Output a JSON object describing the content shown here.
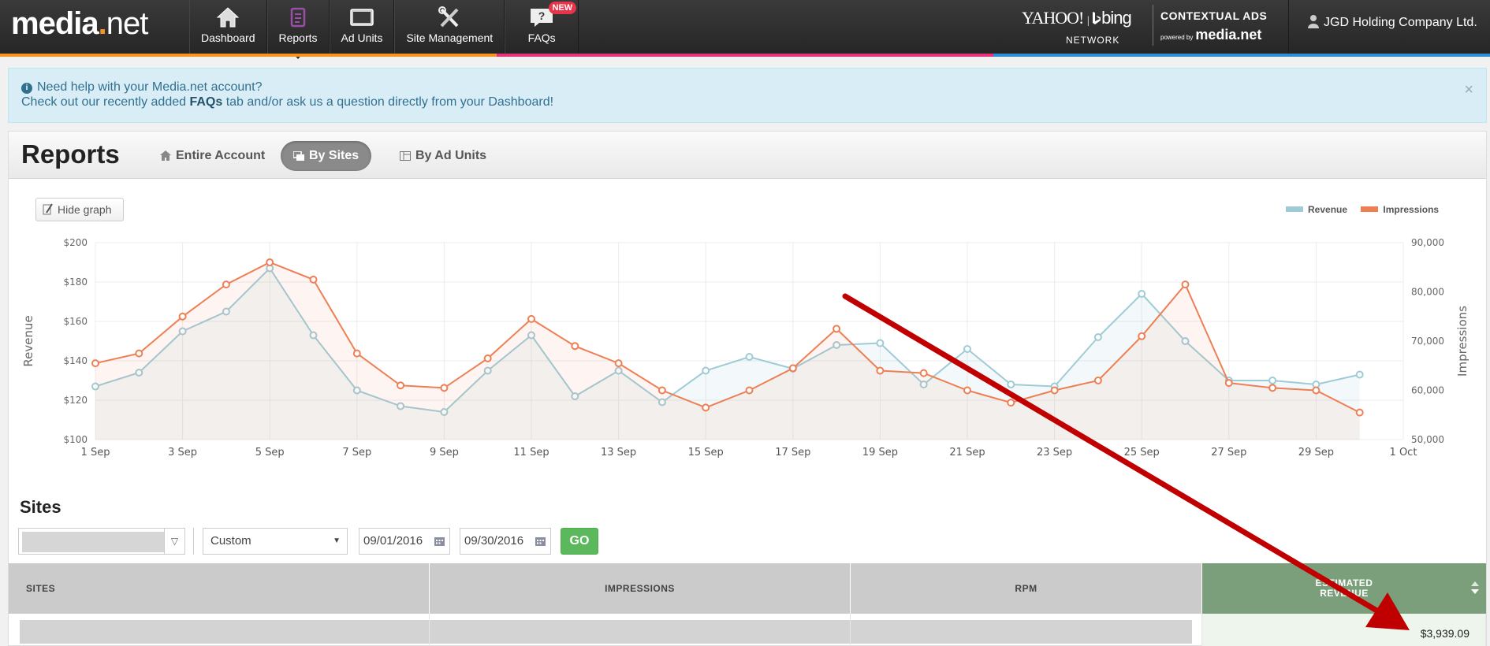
{
  "brand": {
    "logo_main": "media",
    "logo_dot": ".",
    "logo_net": "net"
  },
  "nav": {
    "items": [
      {
        "label": "Dashboard",
        "icon": "house-icon"
      },
      {
        "label": "Reports",
        "icon": "document-icon",
        "active": true
      },
      {
        "label": "Ad Units",
        "icon": "monitor-icon"
      },
      {
        "label": "Site Management",
        "icon": "tools-icon"
      },
      {
        "label": "FAQs",
        "icon": "question-icon",
        "badge": "NEW"
      }
    ]
  },
  "partners": {
    "yahoo": "YAHOO!",
    "bing": "bing",
    "network": "NETWORK",
    "contextual": "CONTEXTUAL ADS",
    "powered_by": "powered by",
    "powered_brand": "media.net"
  },
  "user": {
    "name": "JGD Holding Company Ltd."
  },
  "alert": {
    "line1": "Need help with your Media.net account?",
    "line2_pre": "Check out our recently added ",
    "line2_link": "FAQs",
    "line2_post": " tab and/or ask us a question directly from your Dashboard!",
    "close": "×"
  },
  "reports": {
    "title": "Reports",
    "tabs": [
      {
        "label": "Entire Account"
      },
      {
        "label": "By Sites",
        "active": true
      },
      {
        "label": "By Ad Units"
      }
    ],
    "hide_graph": "Hide graph"
  },
  "legend": {
    "revenue": "Revenue",
    "impressions": "Impressions"
  },
  "colors": {
    "revenue": "#9fcbd6",
    "impressions": "#ee7f54",
    "accent_orange": "#f7931e",
    "accent_pink": "#e8337a",
    "accent_blue": "#2c8fd6",
    "go_green": "#5cb85c",
    "sorted_header": "#7a9f7a"
  },
  "chart_data": {
    "type": "line",
    "x": [
      "1 Sep",
      "2 Sep",
      "3 Sep",
      "4 Sep",
      "5 Sep",
      "6 Sep",
      "7 Sep",
      "8 Sep",
      "9 Sep",
      "10 Sep",
      "11 Sep",
      "12 Sep",
      "13 Sep",
      "14 Sep",
      "15 Sep",
      "16 Sep",
      "17 Sep",
      "18 Sep",
      "19 Sep",
      "20 Sep",
      "21 Sep",
      "22 Sep",
      "23 Sep",
      "24 Sep",
      "25 Sep",
      "26 Sep",
      "27 Sep",
      "28 Sep",
      "29 Sep",
      "30 Sep"
    ],
    "x_ticks": [
      "1 Sep",
      "3 Sep",
      "5 Sep",
      "7 Sep",
      "9 Sep",
      "11 Sep",
      "13 Sep",
      "15 Sep",
      "17 Sep",
      "19 Sep",
      "21 Sep",
      "23 Sep",
      "25 Sep",
      "27 Sep",
      "29 Sep",
      "1 Oct"
    ],
    "series": [
      {
        "name": "Revenue",
        "axis": "left",
        "values": [
          127,
          134,
          155,
          165,
          187,
          153,
          125,
          117,
          114,
          135,
          153,
          122,
          135,
          119,
          135,
          142,
          136,
          148,
          149,
          128,
          146,
          128,
          127,
          152,
          174,
          150,
          130,
          130,
          128,
          133
        ]
      },
      {
        "name": "Impressions",
        "axis": "right",
        "values": [
          65500,
          67500,
          75000,
          81500,
          86000,
          82500,
          67500,
          61000,
          60500,
          66500,
          74500,
          69000,
          65500,
          60000,
          56500,
          60000,
          64500,
          72500,
          64000,
          63500,
          60000,
          57500,
          60000,
          62000,
          71000,
          81500,
          61500,
          60500,
          60000,
          55500
        ]
      }
    ],
    "y_left": {
      "label": "Revenue",
      "ticks": [
        "$100",
        "$120",
        "$140",
        "$160",
        "$180",
        "$200"
      ],
      "range": [
        100,
        200
      ]
    },
    "y_right": {
      "label": "Impressions",
      "ticks": [
        "50,000",
        "60,000",
        "70,000",
        "80,000",
        "90,000"
      ],
      "range": [
        50000,
        90000
      ]
    },
    "grid": true,
    "legend_position": "top-right"
  },
  "sites": {
    "title": "Sites",
    "range_option": "Custom",
    "start_date": "09/01/2016",
    "end_date": "09/30/2016",
    "go": "GO"
  },
  "table": {
    "headers": [
      "SITES",
      "IMPRESSIONS",
      "RPM",
      "ESTIMATED REVENUE"
    ],
    "rows": [
      {
        "revenue": "$3,939.09"
      }
    ]
  }
}
